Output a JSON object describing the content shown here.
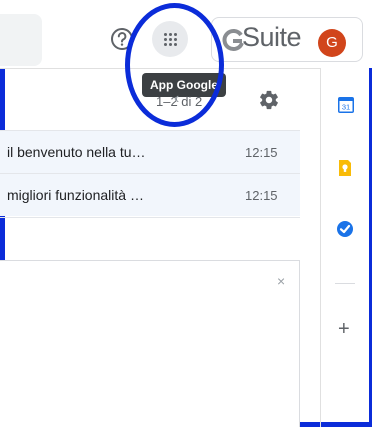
{
  "header": {
    "help_icon": "help-circle-icon",
    "apps_icon": "apps-grid-icon",
    "brand_text": "Suite",
    "avatar_letter": "G",
    "avatar_color": "#d1451b"
  },
  "tooltip": {
    "text": "App Google"
  },
  "toolbar": {
    "pager": "1–2 di 2",
    "prev_icon": "chevron-left-icon",
    "settings_icon": "gear-icon"
  },
  "emails": [
    {
      "subject": "il benvenuto nella tu…",
      "time": "12:15"
    },
    {
      "subject": "migliori funzionalità …",
      "time": "12:15"
    }
  ],
  "panel": {
    "close_label": "×"
  },
  "side_panel": {
    "calendar_label": "31",
    "add_label": "+"
  },
  "colors": {
    "annotation_blue": "#0b2cd9",
    "accent": "#1a73e8"
  }
}
